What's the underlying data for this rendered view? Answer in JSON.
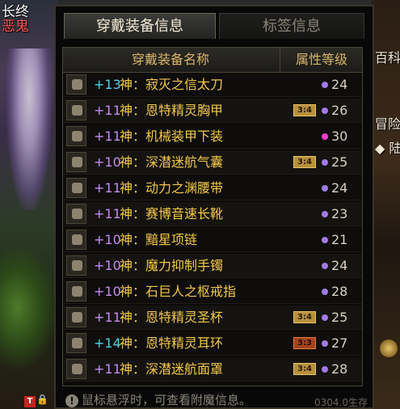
{
  "scene": {
    "left_label_top": "长终",
    "left_label_bottom": "恶鬼",
    "right_text_1": "百科",
    "right_text_2": "冒险",
    "right_text_3": "◆ 陆"
  },
  "tabs": [
    {
      "label": "穿戴装备信息",
      "active": true
    },
    {
      "label": "标签信息",
      "active": false
    }
  ],
  "table": {
    "header_name": "穿戴装备名称",
    "header_level": "属性等级",
    "rows": [
      {
        "plus": "+13",
        "plus_color": "#4fd2e8",
        "name": "神：寂灭之信太刀",
        "badge": "",
        "dot_color": "#a07ae8",
        "level": "24"
      },
      {
        "plus": "+11",
        "plus_color": "#c58af0",
        "name": "神：恩特精灵胸甲",
        "badge": "3:4",
        "badge_type": "gold",
        "dot_color": "#a07ae8",
        "level": "26"
      },
      {
        "plus": "+11",
        "plus_color": "#c58af0",
        "name": "神：机械装甲下装",
        "badge": "",
        "dot_color": "#ff3ad8",
        "level": "30"
      },
      {
        "plus": "+10",
        "plus_color": "#c58af0",
        "name": "神：深潜迷航气囊",
        "badge": "3:4",
        "badge_type": "gold",
        "dot_color": "#a07ae8",
        "level": "25"
      },
      {
        "plus": "+11",
        "plus_color": "#c58af0",
        "name": "神：动力之渊腰带",
        "badge": "",
        "dot_color": "#a07ae8",
        "level": "24"
      },
      {
        "plus": "+11",
        "plus_color": "#c58af0",
        "name": "神：赛博音速长靴",
        "badge": "",
        "dot_color": "#a07ae8",
        "level": "23"
      },
      {
        "plus": "+10",
        "plus_color": "#c58af0",
        "name": "神：黯星项链",
        "badge": "",
        "dot_color": "#a07ae8",
        "level": "21"
      },
      {
        "plus": "+10",
        "plus_color": "#c58af0",
        "name": "神：魔力抑制手镯",
        "badge": "",
        "dot_color": "#a07ae8",
        "level": "24"
      },
      {
        "plus": "+10",
        "plus_color": "#c58af0",
        "name": "神：石巨人之枢戒指",
        "badge": "",
        "dot_color": "#a07ae8",
        "level": "28"
      },
      {
        "plus": "+11",
        "plus_color": "#c58af0",
        "name": "神：恩特精灵圣杯",
        "badge": "3:4",
        "badge_type": "gold",
        "dot_color": "#a07ae8",
        "level": "25"
      },
      {
        "plus": "+14",
        "plus_color": "#4fd2e8",
        "name": "神：恩特精灵耳环",
        "badge": "3:3",
        "badge_type": "red",
        "dot_color": "#a07ae8",
        "level": "27"
      },
      {
        "plus": "+11",
        "plus_color": "#c58af0",
        "name": "神：深潜迷航面罩",
        "badge": "3:4",
        "badge_type": "gold",
        "dot_color": "#a07ae8",
        "level": "28"
      }
    ]
  },
  "footer": {
    "icon": "info-icon",
    "text": "鼠标悬浮时，可查看附魔信息。"
  },
  "watermark": "0304.0生存"
}
